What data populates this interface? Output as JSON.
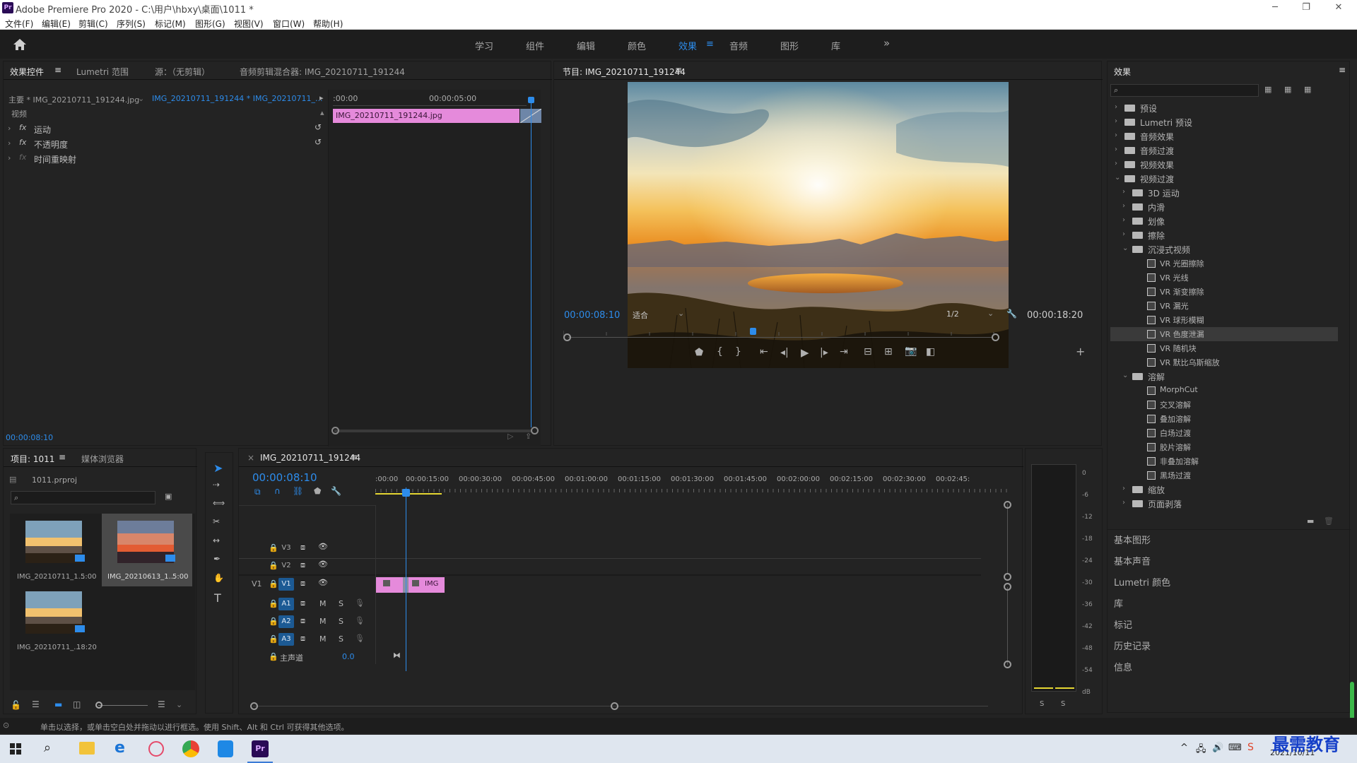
{
  "titlebar": {
    "title": "Adobe Premiere Pro 2020 - C:\\用户\\hbxy\\桌面\\1011 *",
    "app_icon": "Pr"
  },
  "menu": [
    "文件(F)",
    "编辑(E)",
    "剪辑(C)",
    "序列(S)",
    "标记(M)",
    "图形(G)",
    "视图(V)",
    "窗口(W)",
    "帮助(H)"
  ],
  "workspaces": {
    "items": [
      "学习",
      "组件",
      "编辑",
      "颜色",
      "效果",
      "音频",
      "图形",
      "库"
    ],
    "active": "效果",
    "more": "»"
  },
  "effect_controls": {
    "tabs": [
      "效果控件",
      "Lumetri 范围",
      "源：（无剪辑）",
      "音频剪辑混合器: IMG_20210711_191244"
    ],
    "master_label": "主要 * IMG_20210711_191244.jpg",
    "sequence_label": "IMG_20210711_191244 * IMG_20210711_...",
    "section": "视频",
    "rows": [
      "运动",
      "不透明度",
      "时间重映射"
    ],
    "ruler": [
      ":00:00",
      "00:00:05:00"
    ],
    "clip": "IMG_20210711_191244.jpg",
    "timecode": "00:00:08:10"
  },
  "program": {
    "title": "节目: IMG_20210711_191244",
    "timecode": "00:00:08:10",
    "fit": "适合",
    "resolution": "1/2",
    "duration": "00:00:18:20",
    "playhead_fraction": 0.44
  },
  "project": {
    "tabs": [
      "项目: 1011",
      "媒体浏览器"
    ],
    "file": "1011.prproj",
    "items": [
      {
        "name": "IMG_20210711_1...",
        "duration": "5:00"
      },
      {
        "name": "IMG_20210613_1...",
        "duration": "5:00"
      },
      {
        "name": "IMG_20210711_...",
        "duration": "18:20"
      }
    ]
  },
  "timeline": {
    "tab": "IMG_20210711_191244",
    "timecode": "00:00:08:10",
    "ruler": [
      ":00:00",
      "00:00:15:00",
      "00:00:30:00",
      "00:00:45:00",
      "00:01:00:00",
      "00:01:15:00",
      "00:01:30:00",
      "00:01:45:00",
      "00:02:00:00",
      "00:02:15:00",
      "00:02:30:00",
      "00:02:45:"
    ],
    "video_tracks": [
      "V3",
      "V2",
      "V1"
    ],
    "audio_tracks": [
      "A1",
      "A2",
      "A3"
    ],
    "source_patch": "V1",
    "mute_label": "M",
    "solo_label": "S",
    "master_label": "主声道",
    "master_value": "0.0",
    "clip_label": "IMG"
  },
  "meter": {
    "scale": [
      "0",
      "-6",
      "-12",
      "-18",
      "-24",
      "-30",
      "-36",
      "-42",
      "-48",
      "-54",
      "dB"
    ],
    "solo": [
      "S",
      "S"
    ]
  },
  "effects": {
    "title": "效果",
    "tree": [
      {
        "label": "预设",
        "level": 0,
        "type": "folder",
        "open": false
      },
      {
        "label": "Lumetri 预设",
        "level": 0,
        "type": "folder",
        "open": false
      },
      {
        "label": "音频效果",
        "level": 0,
        "type": "folder",
        "open": false
      },
      {
        "label": "音频过渡",
        "level": 0,
        "type": "folder",
        "open": false
      },
      {
        "label": "视频效果",
        "level": 0,
        "type": "folder",
        "open": false
      },
      {
        "label": "视频过渡",
        "level": 0,
        "type": "folder",
        "open": true
      },
      {
        "label": "3D 运动",
        "level": 1,
        "type": "folder",
        "open": false
      },
      {
        "label": "内滑",
        "level": 1,
        "type": "folder",
        "open": false
      },
      {
        "label": "划像",
        "level": 1,
        "type": "folder",
        "open": false
      },
      {
        "label": "擦除",
        "level": 1,
        "type": "folder",
        "open": false
      },
      {
        "label": "沉浸式视频",
        "level": 1,
        "type": "folder",
        "open": true
      },
      {
        "label": "VR 光圈擦除",
        "level": 2,
        "type": "fx"
      },
      {
        "label": "VR 光线",
        "level": 2,
        "type": "fx"
      },
      {
        "label": "VR 渐变擦除",
        "level": 2,
        "type": "fx"
      },
      {
        "label": "VR 漏光",
        "level": 2,
        "type": "fx"
      },
      {
        "label": "VR 球形模糊",
        "level": 2,
        "type": "fx"
      },
      {
        "label": "VR 色度泄漏",
        "level": 2,
        "type": "fx",
        "selected": true
      },
      {
        "label": "VR 随机块",
        "level": 2,
        "type": "fx"
      },
      {
        "label": "VR 默比乌斯缩放",
        "level": 2,
        "type": "fx"
      },
      {
        "label": "溶解",
        "level": 1,
        "type": "folder",
        "open": true
      },
      {
        "label": "MorphCut",
        "level": 2,
        "type": "fx"
      },
      {
        "label": "交叉溶解",
        "level": 2,
        "type": "fx"
      },
      {
        "label": "叠加溶解",
        "level": 2,
        "type": "fx"
      },
      {
        "label": "白场过渡",
        "level": 2,
        "type": "fx"
      },
      {
        "label": "胶片溶解",
        "level": 2,
        "type": "fx"
      },
      {
        "label": "非叠加溶解",
        "level": 2,
        "type": "fx"
      },
      {
        "label": "黑场过渡",
        "level": 2,
        "type": "fx"
      },
      {
        "label": "缩放",
        "level": 1,
        "type": "folder",
        "open": false
      },
      {
        "label": "页面剥落",
        "level": 1,
        "type": "folder",
        "open": false
      }
    ],
    "panels": [
      "基本图形",
      "基本声音",
      "Lumetri 颜色",
      "库",
      "标记",
      "历史记录",
      "信息"
    ]
  },
  "status": "单击以选择，或单击空白处并拖动以进行框选。使用 Shift、Alt 和 Ctrl 可获得其他选项。",
  "taskbar": {
    "date": "2021/10/11",
    "watermark": "最需教育"
  },
  "colors": {
    "accent": "#2d8ceb",
    "clip_pink": "#e58adb",
    "panel_bg": "#232323"
  }
}
